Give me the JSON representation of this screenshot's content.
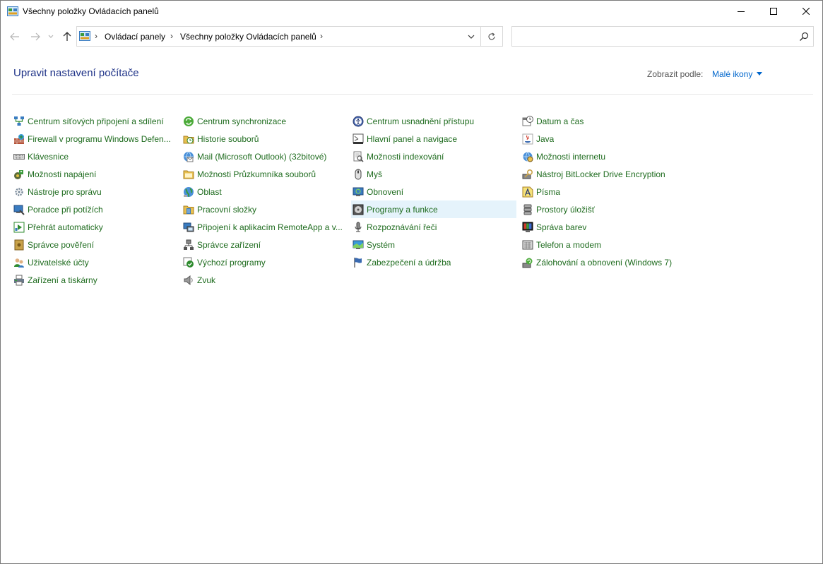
{
  "window": {
    "title": "Všechny položky Ovládacích panelů",
    "accent": "#0066cc",
    "link_color": "#1e6b1e",
    "title_color": "#1e3287"
  },
  "nav": {
    "back": "←",
    "forward": "→",
    "up": "↑",
    "separator": "›",
    "breadcrumbs": [
      "Ovládací panely",
      "Všechny položky Ovládacích panelů"
    ],
    "refresh": "↻",
    "search_placeholder": ""
  },
  "header": {
    "title": "Upravit nastavení počítače",
    "view_label": "Zobrazit podle:",
    "view_value": "Malé ikony"
  },
  "columns": [
    [
      {
        "label": "Centrum síťových připojení a sdílení",
        "icon": "network-icon"
      },
      {
        "label": "Firewall v programu Windows Defen...",
        "icon": "firewall-icon"
      },
      {
        "label": "Klávesnice",
        "icon": "keyboard-icon"
      },
      {
        "label": "Možnosti napájení",
        "icon": "power-icon"
      },
      {
        "label": "Nástroje pro správu",
        "icon": "admin-tools-icon"
      },
      {
        "label": "Poradce při potížích",
        "icon": "troubleshoot-icon"
      },
      {
        "label": "Přehrát automaticky",
        "icon": "autoplay-icon"
      },
      {
        "label": "Správce pověření",
        "icon": "credential-icon"
      },
      {
        "label": "Uživatelské účty",
        "icon": "user-accounts-icon"
      },
      {
        "label": "Zařízení a tiskárny",
        "icon": "printer-icon"
      }
    ],
    [
      {
        "label": "Centrum synchronizace",
        "icon": "sync-icon"
      },
      {
        "label": "Historie souborů",
        "icon": "file-history-icon"
      },
      {
        "label": "Mail (Microsoft Outlook) (32bitové)",
        "icon": "mail-icon"
      },
      {
        "label": "Možnosti Průzkumníka souborů",
        "icon": "folder-options-icon"
      },
      {
        "label": "Oblast",
        "icon": "region-icon"
      },
      {
        "label": "Pracovní složky",
        "icon": "work-folders-icon"
      },
      {
        "label": "Připojení k aplikacím RemoteApp a v...",
        "icon": "remoteapp-icon"
      },
      {
        "label": "Správce zařízení",
        "icon": "device-manager-icon"
      },
      {
        "label": "Výchozí programy",
        "icon": "default-programs-icon"
      },
      {
        "label": "Zvuk",
        "icon": "sound-icon"
      }
    ],
    [
      {
        "label": "Centrum usnadnění přístupu",
        "icon": "ease-of-access-icon"
      },
      {
        "label": "Hlavní panel a navigace",
        "icon": "taskbar-icon"
      },
      {
        "label": "Možnosti indexování",
        "icon": "indexing-icon"
      },
      {
        "label": "Myš",
        "icon": "mouse-icon"
      },
      {
        "label": "Obnovení",
        "icon": "recovery-icon"
      },
      {
        "label": "Programy a funkce",
        "icon": "programs-icon"
      },
      {
        "label": "Rozpoznávání řeči",
        "icon": "speech-icon"
      },
      {
        "label": "Systém",
        "icon": "system-icon"
      },
      {
        "label": "Zabezpečení a údržba",
        "icon": "security-flag-icon"
      }
    ],
    [
      {
        "label": "Datum a čas",
        "icon": "datetime-icon"
      },
      {
        "label": "Java",
        "icon": "java-icon"
      },
      {
        "label": "Možnosti internetu",
        "icon": "internet-options-icon"
      },
      {
        "label": "Nástroj BitLocker Drive Encryption",
        "icon": "bitlocker-icon"
      },
      {
        "label": "Písma",
        "icon": "fonts-icon"
      },
      {
        "label": "Prostory úložišť",
        "icon": "storage-spaces-icon"
      },
      {
        "label": "Správa barev",
        "icon": "color-management-icon"
      },
      {
        "label": "Telefon a modem",
        "icon": "phone-modem-icon"
      },
      {
        "label": "Zálohování a obnovení (Windows 7)",
        "icon": "backup-icon"
      }
    ]
  ],
  "hovered_item": "Programy a funkce"
}
